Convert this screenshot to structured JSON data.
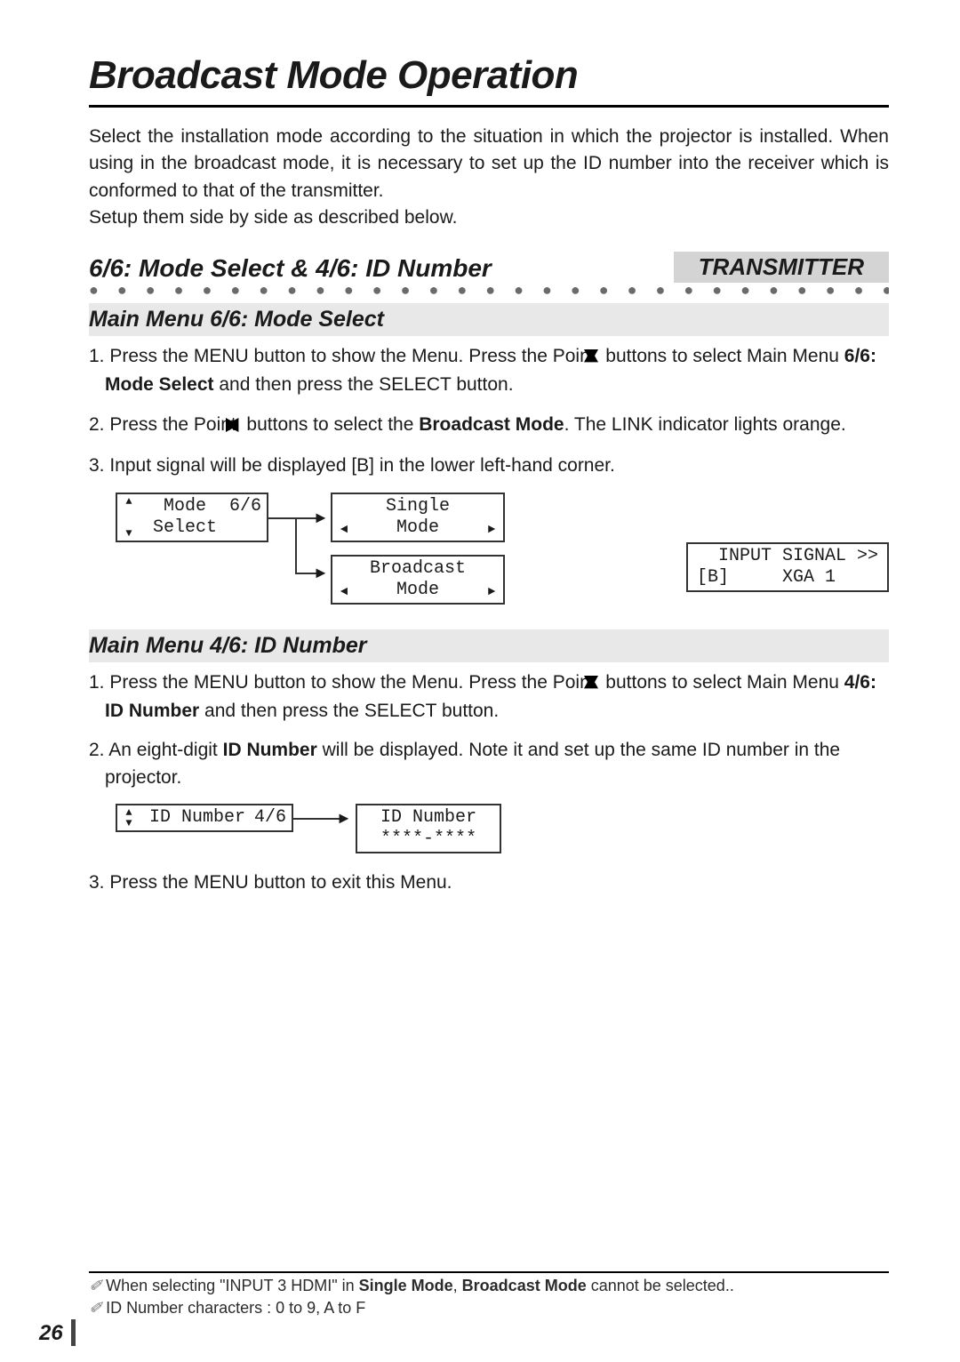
{
  "page": {
    "number": "26"
  },
  "title": "Broadcast Mode Operation",
  "intro": [
    "Select the installation mode according to the situation in which the projector is installed. When using in the broadcast mode, it is necessary to set up the ID number into the receiver which is conformed to that of the transmitter.",
    "Setup them side by side as described below."
  ],
  "section": {
    "heading": "6/6: Mode Select & 4/6: ID Number",
    "badge": "TRANSMITTER"
  },
  "modeSelect": {
    "heading": "Main Menu 6/6: Mode Select",
    "step1_a": "1. Press the MENU button to show the Menu. Press the Point ",
    "step1_b": " buttons to select Main Menu ",
    "step1_bold": "6/6: Mode Select",
    "step1_c": " and then press the SELECT button.",
    "step2_a": "2. Press the Point ",
    "step2_b": " buttons to select the ",
    "step2_bold": "Broadcast Mode",
    "step2_c": ". The LINK indicator lights orange.",
    "step3": "3. Input signal will be displayed [B] in the lower left-hand corner.",
    "menu": {
      "label": "Mode\nSelect",
      "page": "6/6"
    },
    "opt1": "Single\nMode",
    "opt2": "Broadcast\nMode",
    "signal": "  INPUT SIGNAL >>\n[B]     XGA 1"
  },
  "idNumber": {
    "heading": "Main Menu 4/6: ID Number",
    "step1_a": "1. Press the MENU button to show the Menu. Press the Point ",
    "step1_b": " buttons to select Main Menu ",
    "step1_bold": "4/6: ID Number",
    "step1_c": " and then press the SELECT button.",
    "step2_a": "2. An eight-digit ",
    "step2_bold": "ID Number",
    "step2_b": " will be displayed. Note it and set up the same ID number in the projector.",
    "menu": {
      "label": "ID Number",
      "page": "4/6"
    },
    "opt": "ID Number\n****-****",
    "step3": "3. Press the MENU button to exit this Menu."
  },
  "footnotes": {
    "f1_a": "When selecting \"INPUT 3 HDMI\" in ",
    "f1_b1": "Single Mode",
    "f1_c": ", ",
    "f1_b2": "Broadcast Mode",
    "f1_d": " cannot be selected..",
    "f2": "ID Number characters : 0 to 9, A to F"
  },
  "glyphs": {
    "up": "▲",
    "down": "▼",
    "left": "◄",
    "right": "►",
    "pencil": "✐"
  }
}
